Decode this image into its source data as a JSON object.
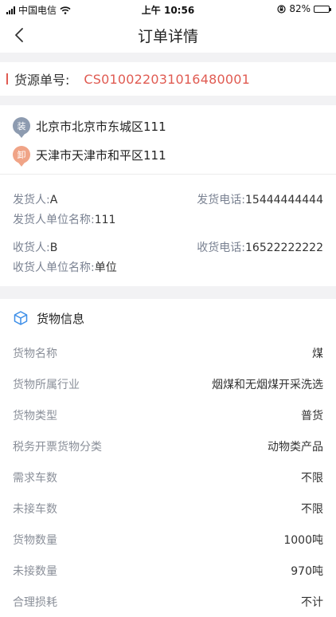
{
  "status_bar": {
    "carrier": "中国电信",
    "time": "上午 10:56",
    "battery": "82%",
    "battery_level": 0.82
  },
  "nav": {
    "title": "订单详情"
  },
  "order": {
    "label": "货源单号:",
    "number": "CS010022031016480001"
  },
  "addresses": {
    "load": {
      "tag": "装",
      "text": "北京市北京市东城区111"
    },
    "unload": {
      "tag": "卸",
      "text": "天津市天津市和平区111"
    }
  },
  "parties": {
    "sender": {
      "name_label": "发货人:",
      "name": "A",
      "phone_label": "发货电话:",
      "phone": "15444444444",
      "unit_label": "发货人单位名称:",
      "unit": "111"
    },
    "receiver": {
      "name_label": "收货人:",
      "name": "B",
      "phone_label": "收货电话:",
      "phone": "16522222222",
      "unit_label": "收货人单位名称:",
      "unit": "单位"
    }
  },
  "goods": {
    "title": "货物信息",
    "rows": [
      {
        "label": "货物名称",
        "value": "煤"
      },
      {
        "label": "货物所属行业",
        "value": "烟煤和无烟煤开采洗选"
      },
      {
        "label": "货物类型",
        "value": "普货"
      },
      {
        "label": "税务开票货物分类",
        "value": "动物类产品"
      },
      {
        "label": "需求车数",
        "value": "不限"
      },
      {
        "label": "未接车数",
        "value": "不限"
      },
      {
        "label": "货物数量",
        "value": "1000吨"
      },
      {
        "label": "未接数量",
        "value": "970吨"
      },
      {
        "label": "合理损耗",
        "value": "不计"
      }
    ]
  }
}
